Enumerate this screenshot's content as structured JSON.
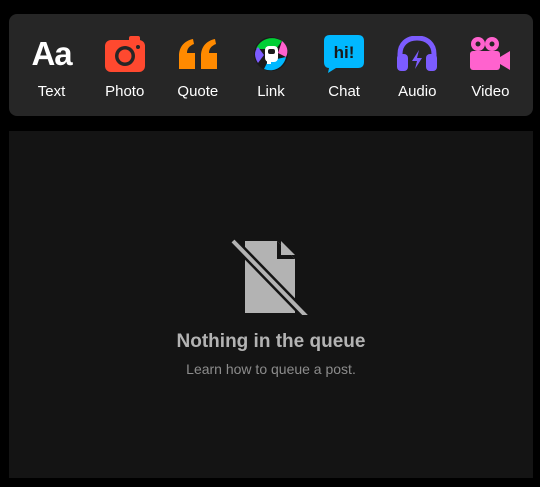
{
  "post_types": [
    {
      "label": "Text",
      "icon": "text-aa-icon",
      "color": "#ffffff"
    },
    {
      "label": "Photo",
      "icon": "camera-icon",
      "color": "#ff492f"
    },
    {
      "label": "Quote",
      "icon": "quote-marks-icon",
      "color": "#ff8a00"
    },
    {
      "label": "Link",
      "icon": "link-orb-icon",
      "color": "#00cf35"
    },
    {
      "label": "Chat",
      "icon": "chat-bubble-icon",
      "color": "#00b8ff"
    },
    {
      "label": "Audio",
      "icon": "headphones-icon",
      "color": "#7c5cff"
    },
    {
      "label": "Video",
      "icon": "video-camera-icon",
      "color": "#ff62ce"
    }
  ],
  "text_icon_glyph": "Aa",
  "chat_icon_glyph": "hi!",
  "empty_state": {
    "icon": "no-document-icon",
    "title": "Nothing in the queue",
    "subtitle": "Learn how to queue a post."
  }
}
